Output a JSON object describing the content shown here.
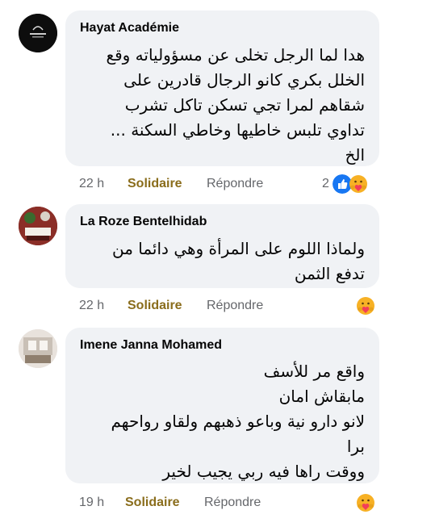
{
  "colors": {
    "bubble": "#f0f2f5",
    "meta_text": "#65676b",
    "solidaire": "#8a6d1c",
    "like_blue": "#1877f2",
    "care_yellow": "#f7b125",
    "care_heart": "#f33e58"
  },
  "comments": [
    {
      "author": "Hayat Académie",
      "text": "هدا لما الرجل تخلى عن مسؤولياته وقع\nالخلل بكري كانو الرجال قادرين على\nشقاهم لمرا تجي تسكن تاكل تشرب\nتداوي تلبس خاطيها وخاطي السكنة ...\nالخ",
      "time": "22 h",
      "reaction_label": "Solidaire",
      "reply_label": "Répondre",
      "reaction_count": "2",
      "reaction_icons": [
        "like-icon",
        "care-icon"
      ]
    },
    {
      "author": "La Roze Bentelhidab",
      "text": "ولماذا اللوم على المرأة وهي دائما من\nتدفع الثمن",
      "time": "22 h",
      "reaction_label": "Solidaire",
      "reply_label": "Répondre",
      "reaction_icons": [
        "care-icon"
      ]
    },
    {
      "author": "Imene Janna Mohamed",
      "text": "واقع مر للأسف\nمابقاش امان\nلانو دارو نية وباعو ذهبهم ولقاو رواحهم\nبرا\nووقت راها فيه ربي يجيب لخير",
      "time": "19 h",
      "reaction_label": "Solidaire",
      "reply_label": "Répondre",
      "reaction_icons": [
        "care-icon"
      ]
    }
  ]
}
